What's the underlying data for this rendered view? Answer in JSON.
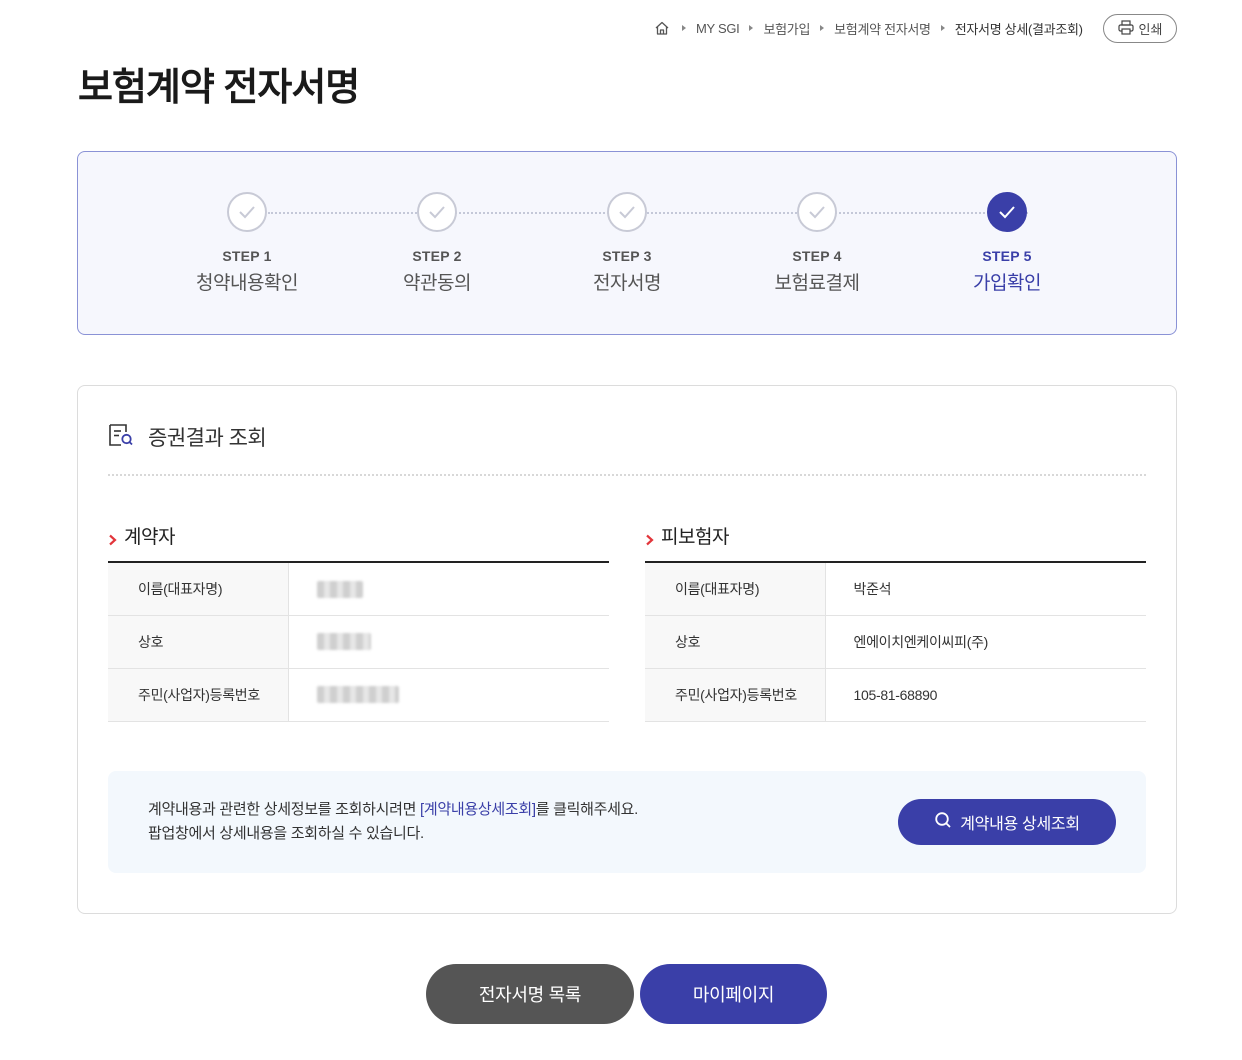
{
  "breadcrumb": {
    "items": [
      "MY SGI",
      "보험가입",
      "보험계약 전자서명",
      "전자서명 상세(결과조회)"
    ],
    "print_label": "인쇄"
  },
  "page_title": "보험계약 전자서명",
  "steps": [
    {
      "num": "STEP 1",
      "name": "청약내용확인",
      "done": true
    },
    {
      "num": "STEP 2",
      "name": "약관동의",
      "done": true
    },
    {
      "num": "STEP 3",
      "name": "전자서명",
      "done": true
    },
    {
      "num": "STEP 4",
      "name": "보험료결제",
      "done": true
    },
    {
      "num": "STEP 5",
      "name": "가입확인",
      "active": true
    }
  ],
  "result": {
    "title": "증권결과 조회",
    "contractor": {
      "heading": "계약자",
      "rows": [
        {
          "label": "이름(대표자명)",
          "value": ""
        },
        {
          "label": "상호",
          "value": ""
        },
        {
          "label": "주민(사업자)등록번호",
          "value": ""
        }
      ]
    },
    "insured": {
      "heading": "피보험자",
      "rows": [
        {
          "label": "이름(대표자명)",
          "value": "박준석"
        },
        {
          "label": "상호",
          "value": "엔에이치엔케이씨피(주)"
        },
        {
          "label": "주민(사업자)등록번호",
          "value": "105-81-68890"
        }
      ]
    },
    "notice": {
      "line1_pre": "계약내용과 관련한 상세정보를 조회하시려면 ",
      "line1_link": "[계약내용상세조회]",
      "line1_post": "를 클릭해주세요.",
      "line2": "팝업창에서 상세내용을 조회하실 수 있습니다."
    },
    "detail_button": "계약내용 상세조회"
  },
  "buttons": {
    "list": "전자서명 목록",
    "mypage": "마이페이지"
  },
  "colors": {
    "primary": "#3a3fa8",
    "step_border": "#8a92d6",
    "step_bg": "#f6f7fd",
    "notice_bg": "#f3f8fd",
    "dark_button": "#555555"
  }
}
